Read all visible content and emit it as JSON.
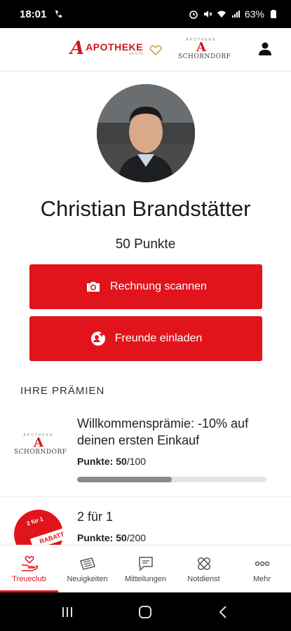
{
  "status_bar": {
    "time": "18:01",
    "battery": "63%"
  },
  "header": {
    "logo_apotheke": "APOTHEKE",
    "logo_apotheke_sub": "am KITS",
    "logo_schorndorf": "SCHORNDORF",
    "logo_schorndorf_ring": "APOTHEKE"
  },
  "profile": {
    "name": "Christian Brandstätter",
    "points": "50 Punkte"
  },
  "actions": {
    "scan_label": "Rechnung scannen",
    "invite_label": "Freunde einladen"
  },
  "rewards_section": {
    "title": "IHRE PRÄMIEN"
  },
  "rewards": [
    {
      "title": "Willkommensprämie: -10% auf deinen ersten Einkauf",
      "points_label": "Punkte:",
      "points_current": "50",
      "points_total": "/100",
      "progress": 0.5,
      "logo_text": "SCHORNDORF",
      "logo_ring": "APOTHEKE"
    },
    {
      "title": "2 für 1",
      "points_label": "Punkte:",
      "points_current": "50",
      "points_total": "/200",
      "badge_top": "2 für 1",
      "badge_bottom": "RABATT"
    }
  ],
  "bottom_nav": [
    {
      "label": "Treueclub",
      "icon": "heart-hand-icon",
      "active": true
    },
    {
      "label": "Neuigkeiten",
      "icon": "newspaper-icon",
      "active": false
    },
    {
      "label": "Mitteilungen",
      "icon": "message-icon",
      "active": false
    },
    {
      "label": "Notdienst",
      "icon": "bandage-icon",
      "active": false
    },
    {
      "label": "Mehr",
      "icon": "more-icon",
      "active": false
    }
  ],
  "colors": {
    "brand_red": "#e1141c",
    "progress_fill": "#8a8a8a"
  }
}
